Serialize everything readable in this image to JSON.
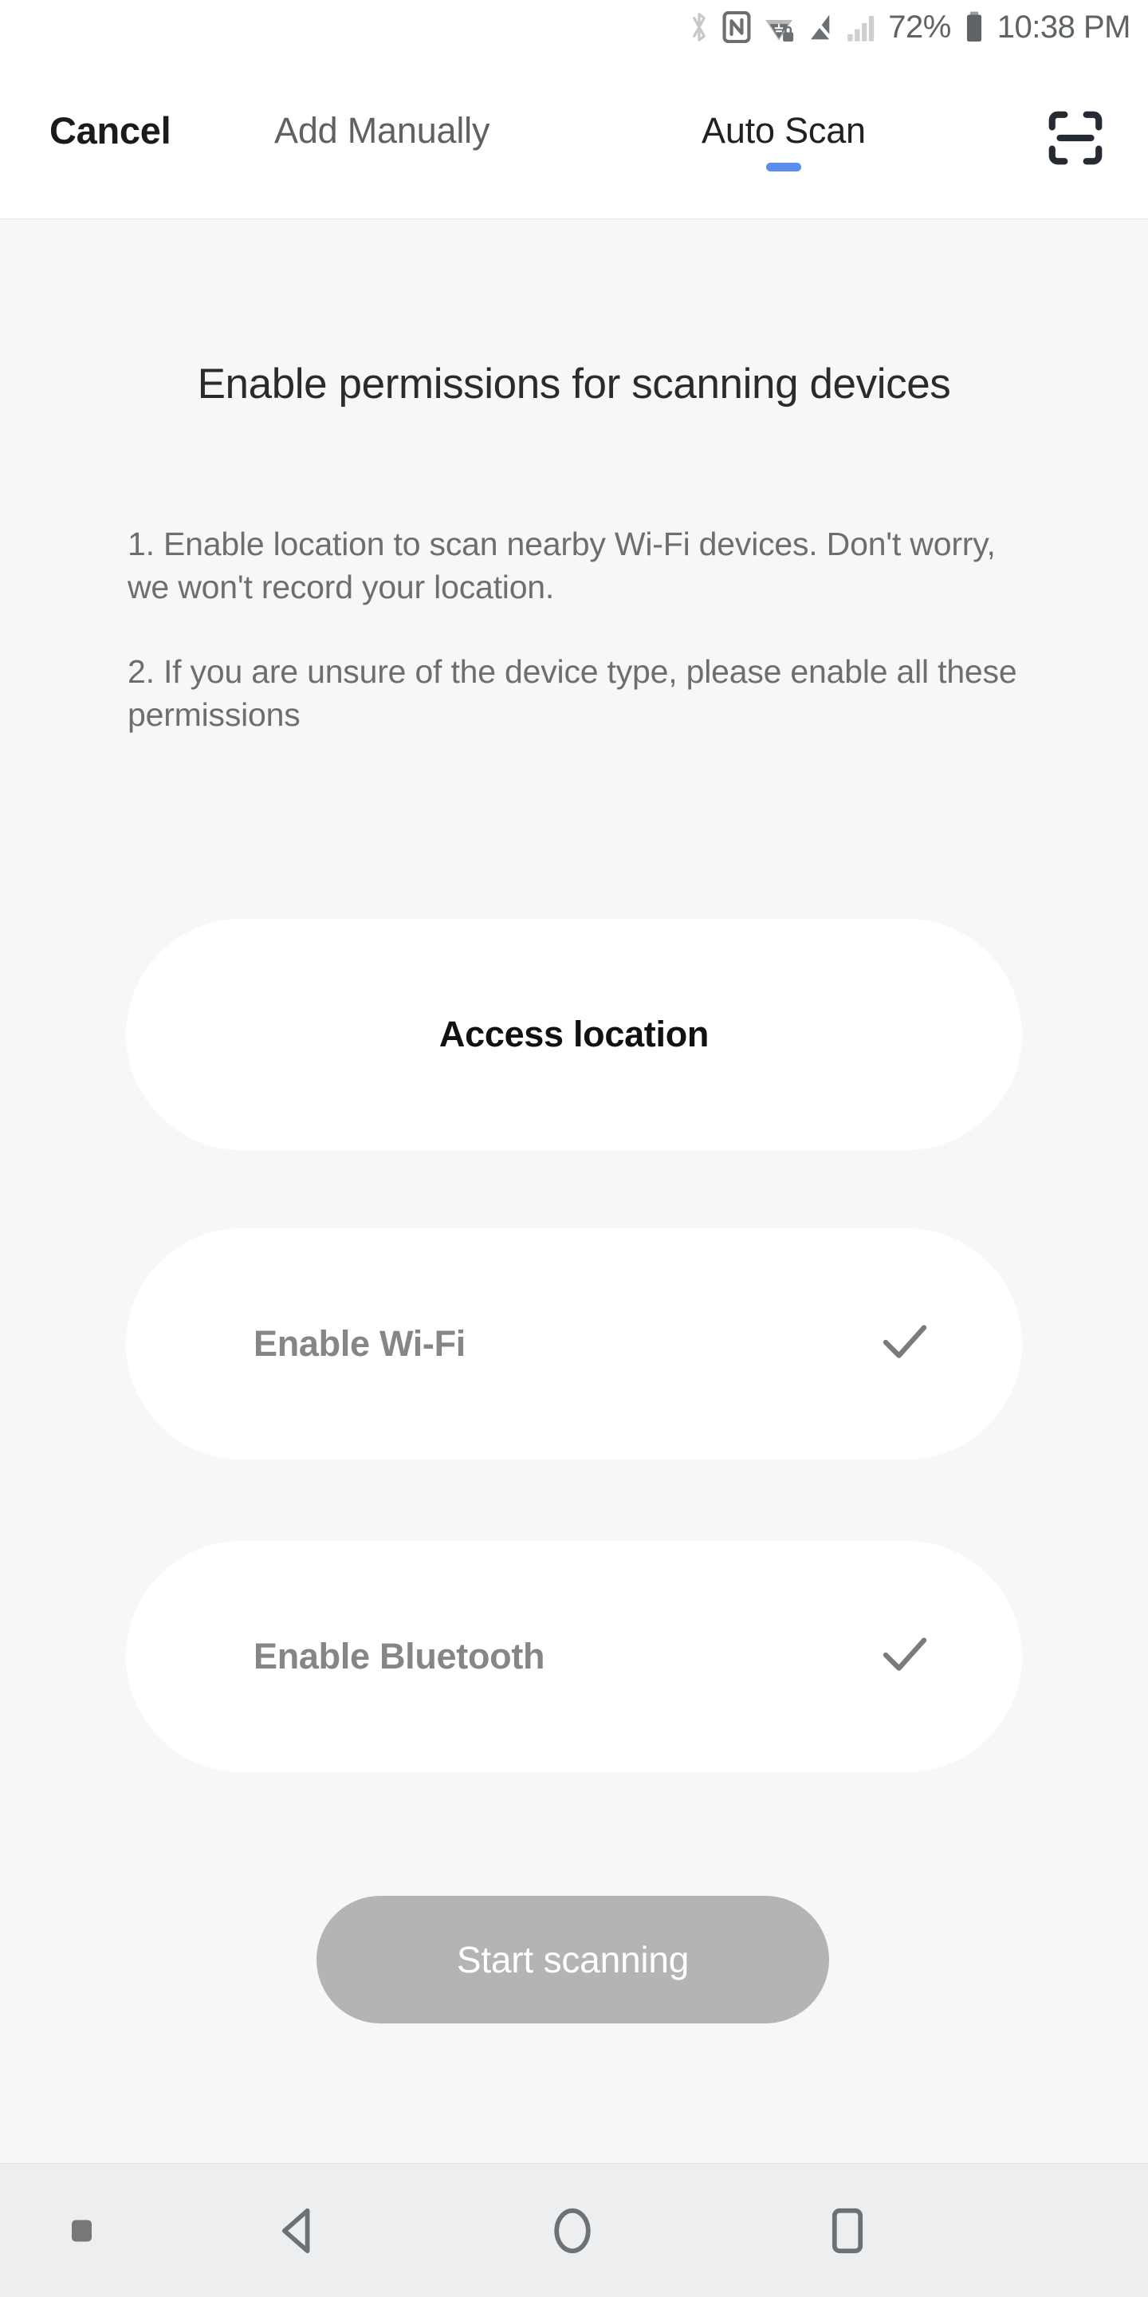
{
  "status_bar": {
    "icons": [
      "bluetooth-icon",
      "nfc-icon",
      "wifi-vpn-icon",
      "signal-off-icon",
      "signal-bars-icon"
    ],
    "battery_percent": "72%",
    "battery_icon": "battery-icon",
    "time": "10:38 PM"
  },
  "header": {
    "cancel_label": "Cancel",
    "add_manually_label": "Add Manually",
    "auto_scan_label": "Auto Scan",
    "active_tab": "Auto Scan",
    "scan_icon": "scan-qr-icon",
    "accent_color": "#5a8dee"
  },
  "main": {
    "heading": "Enable permissions for scanning devices",
    "instructions": [
      "1. Enable location to scan nearby Wi-Fi devices. Don't worry, we won't record your location.",
      "2. If you are unsure of the device type, please enable all these permissions"
    ],
    "permissions": [
      {
        "label": "Access location",
        "checked": false,
        "align": "center"
      },
      {
        "label": "Enable Wi-Fi",
        "checked": true,
        "align": "left"
      },
      {
        "label": "Enable Bluetooth",
        "checked": true,
        "align": "left"
      }
    ],
    "start_button": {
      "label": "Start scanning",
      "enabled": false,
      "background": "#b4b4b4",
      "text_color": "#ffffff"
    }
  },
  "nav_bar": {
    "items": [
      "hide-navbar-dot",
      "back-icon",
      "home-icon",
      "recents-icon"
    ]
  }
}
